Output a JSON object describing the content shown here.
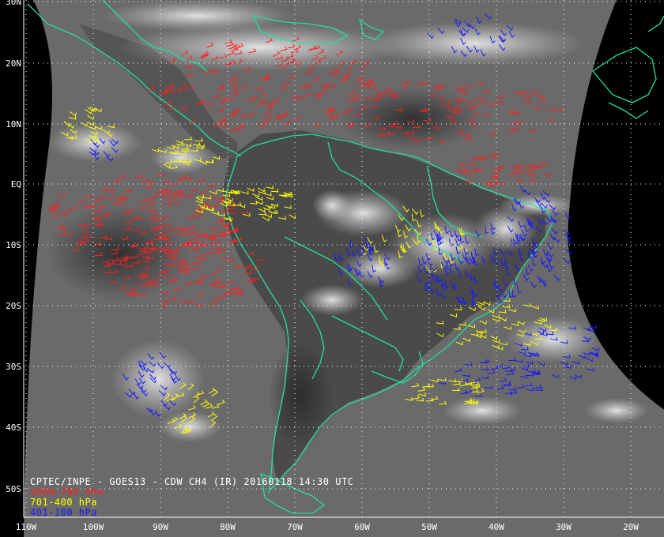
{
  "title": "CPTEC/INPE - GOES13 - CDW CH4 (IR) 20160118 14:30 UTC",
  "legend": [
    {
      "label": "1000-700 hPa",
      "color": "#ff2020"
    },
    {
      "label": "701-400 hPa",
      "color": "#ffff00"
    },
    {
      "label": "401-100 hPa",
      "color": "#1818ff"
    }
  ],
  "lat_labels": [
    "30N",
    "20N",
    "10N",
    "EQ",
    "10S",
    "20S",
    "30S",
    "40S",
    "50S"
  ],
  "lon_labels": [
    "110W",
    "100W",
    "90W",
    "80W",
    "70W",
    "60W",
    "50W",
    "40W",
    "30W",
    "20W"
  ],
  "colors": {
    "coast": "#20e0a0",
    "grid": "#ffffff",
    "background": "#000000"
  }
}
